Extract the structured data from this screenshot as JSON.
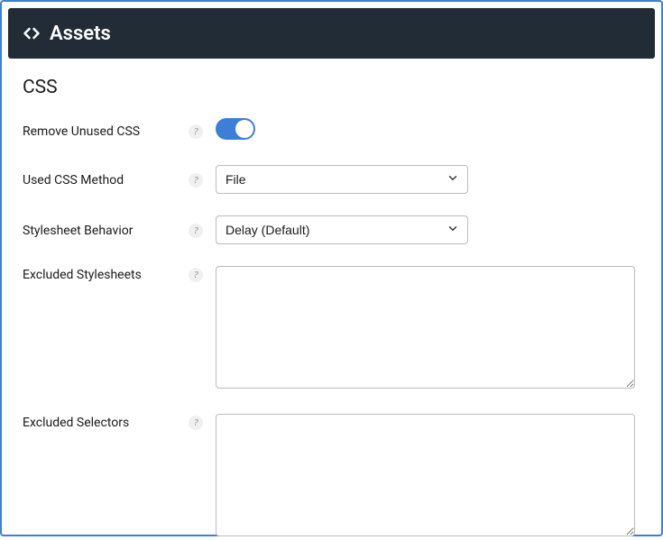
{
  "header": {
    "title": "Assets"
  },
  "section": {
    "title": "CSS"
  },
  "labels": {
    "remove_unused_css": "Remove Unused CSS",
    "used_css_method": "Used CSS Method",
    "stylesheet_behavior": "Stylesheet Behavior",
    "excluded_stylesheets": "Excluded Stylesheets",
    "excluded_selectors": "Excluded Selectors"
  },
  "values": {
    "remove_unused_css": true,
    "used_css_method": "File",
    "stylesheet_behavior": "Delay (Default)",
    "excluded_stylesheets": "",
    "excluded_selectors": ""
  },
  "help_glyph": "?"
}
